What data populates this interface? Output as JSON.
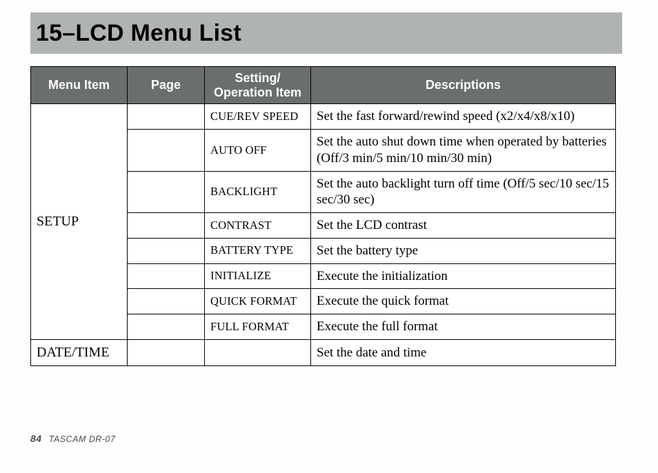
{
  "title": "15–LCD Menu List",
  "headers": {
    "menu_item": "Menu Item",
    "page": "Page",
    "setting_line1": "Setting/",
    "setting_line2": "Operation Item",
    "descriptions": "Descriptions"
  },
  "rows": [
    {
      "menu_item": "SETUP",
      "page": "",
      "setting": "CUE/REV SPEED",
      "description": "Set the fast forward/rewind speed (x2/x4/x8/x10)"
    },
    {
      "menu_item": "",
      "page": "",
      "setting": "AUTO OFF",
      "description": "Set the auto shut down time when operated by batteries (Off/3 min/5 min/10 min/30 min)"
    },
    {
      "menu_item": "",
      "page": "",
      "setting": "BACKLIGHT",
      "description": "Set the auto backlight turn off time (Off/5 sec/10 sec/15 sec/30 sec)"
    },
    {
      "menu_item": "",
      "page": "",
      "setting": "CONTRAST",
      "description": "Set the LCD contrast"
    },
    {
      "menu_item": "",
      "page": "",
      "setting": "BATTERY TYPE",
      "description": "Set the battery type"
    },
    {
      "menu_item": "",
      "page": "",
      "setting": "INITIALIZE",
      "description": "Execute the initialization"
    },
    {
      "menu_item": "",
      "page": "",
      "setting": "QUICK FORMAT",
      "description": "Execute the quick format"
    },
    {
      "menu_item": "",
      "page": "",
      "setting": "FULL FORMAT",
      "description": "Execute the full format"
    },
    {
      "menu_item": "DATE/TIME",
      "page": "",
      "setting": "",
      "description": "Set the date and time"
    }
  ],
  "footer": {
    "page_number": "84",
    "model": "TASCAM  DR-07"
  }
}
